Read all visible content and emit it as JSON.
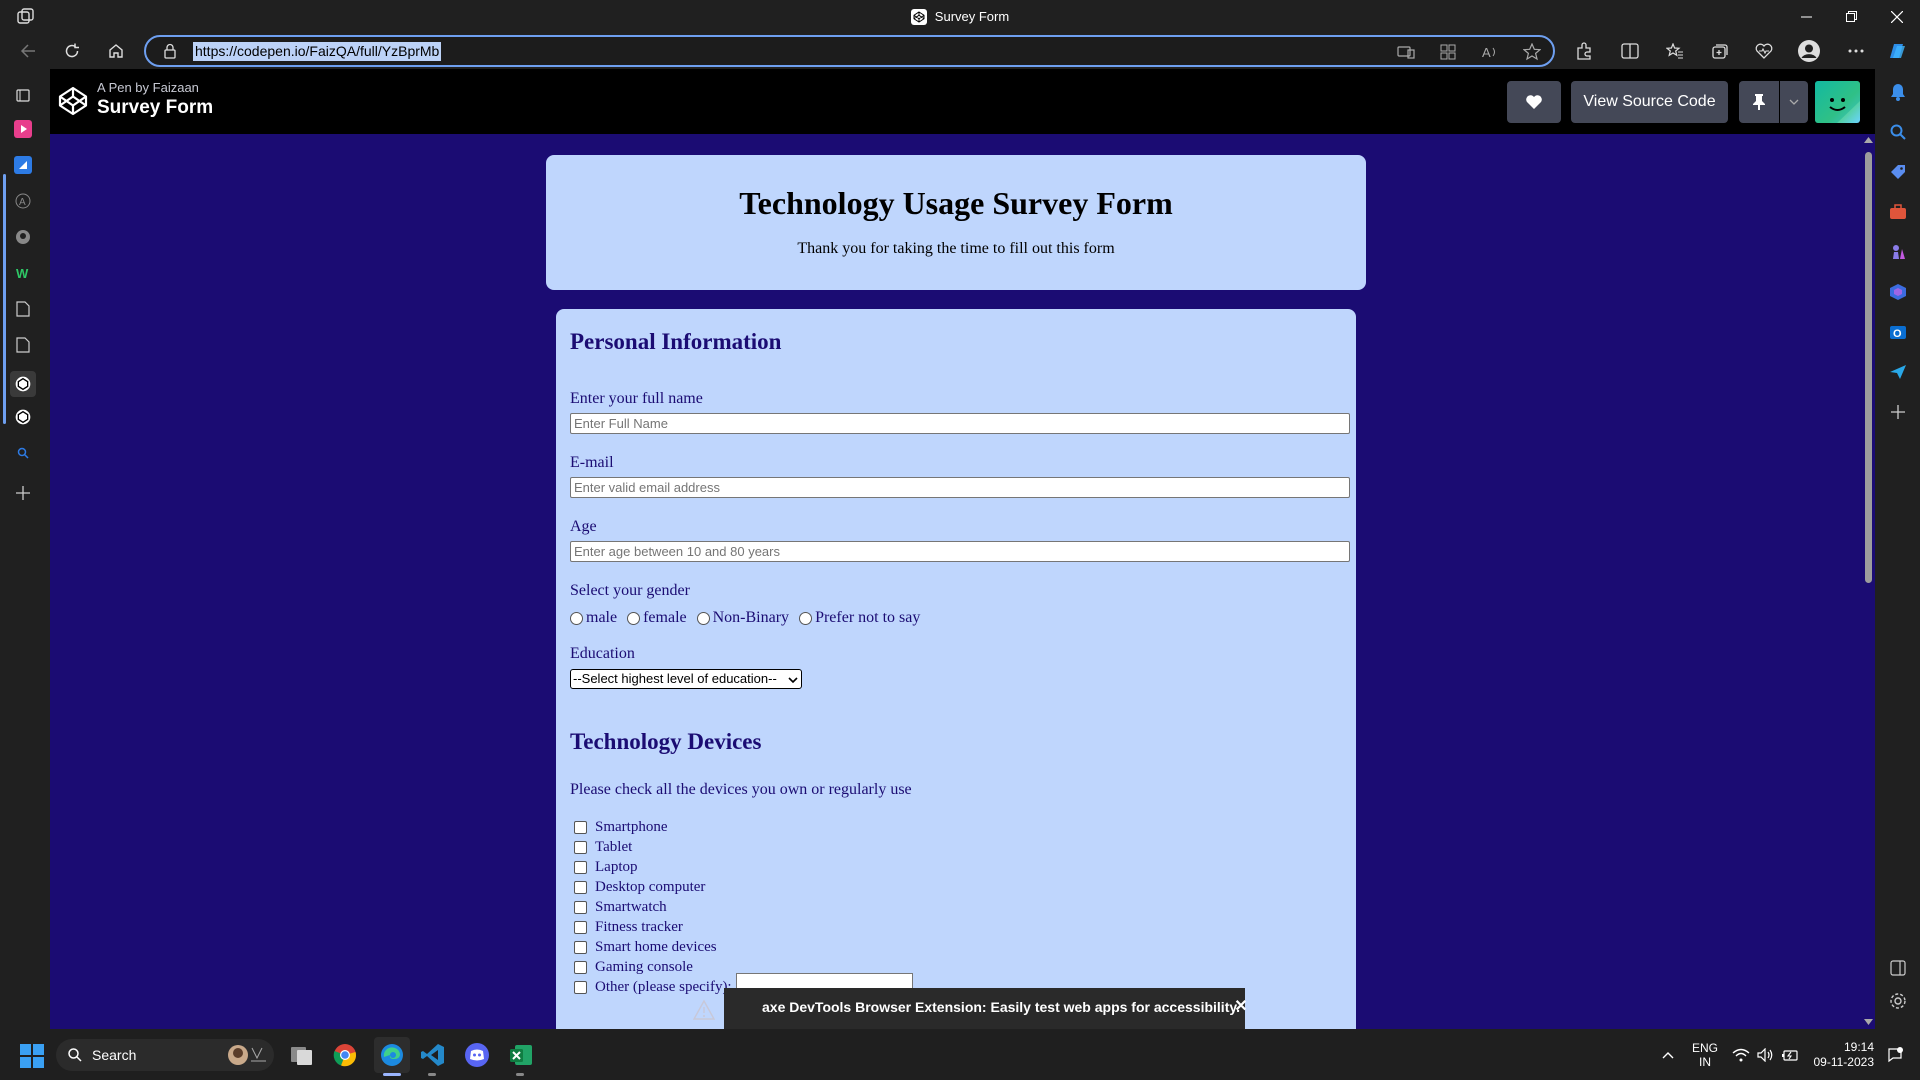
{
  "window": {
    "title": "Survey Form"
  },
  "address_bar": {
    "url": "https://codepen.io/FaizQA/full/YzBprMb"
  },
  "codepen": {
    "byline": "A Pen by Faizaan",
    "pen_title": "Survey Form",
    "view_source_label": "View Source Code"
  },
  "survey": {
    "title": "Technology Usage Survey Form",
    "description": "Thank you for taking the time to fill out this form",
    "personal_section": "Personal Information",
    "name_label": "Enter your full name",
    "name_placeholder": "Enter Full Name",
    "email_label": "E-mail",
    "email_placeholder": "Enter valid email address",
    "age_label": "Age",
    "age_placeholder": "Enter age between 10 and 80 years",
    "gender_label": "Select your gender",
    "gender_options": [
      "male",
      "female",
      "Non-Binary",
      "Prefer not to say"
    ],
    "education_label": "Education",
    "education_selected": "--Select highest level of education--",
    "devices_section": "Technology Devices",
    "devices_prompt": "Please check all the devices you own or regularly use",
    "devices": [
      "Smartphone",
      "Tablet",
      "Laptop",
      "Desktop computer",
      "Smartwatch",
      "Fitness tracker",
      "Smart home devices",
      "Gaming console",
      "Other (please specify):"
    ]
  },
  "toast": {
    "message": "axe DevTools Browser Extension: Easily test web apps for accessibility."
  },
  "taskbar": {
    "search_label": "Search",
    "lang_line1": "ENG",
    "lang_line2": "IN",
    "time": "19:14",
    "date": "09-11-2023"
  },
  "colors": {
    "page_background": "#1b0c73",
    "form_background": "#bfd6fd",
    "codepen_header": "#000000",
    "address_focus": "#6e9ff0"
  }
}
